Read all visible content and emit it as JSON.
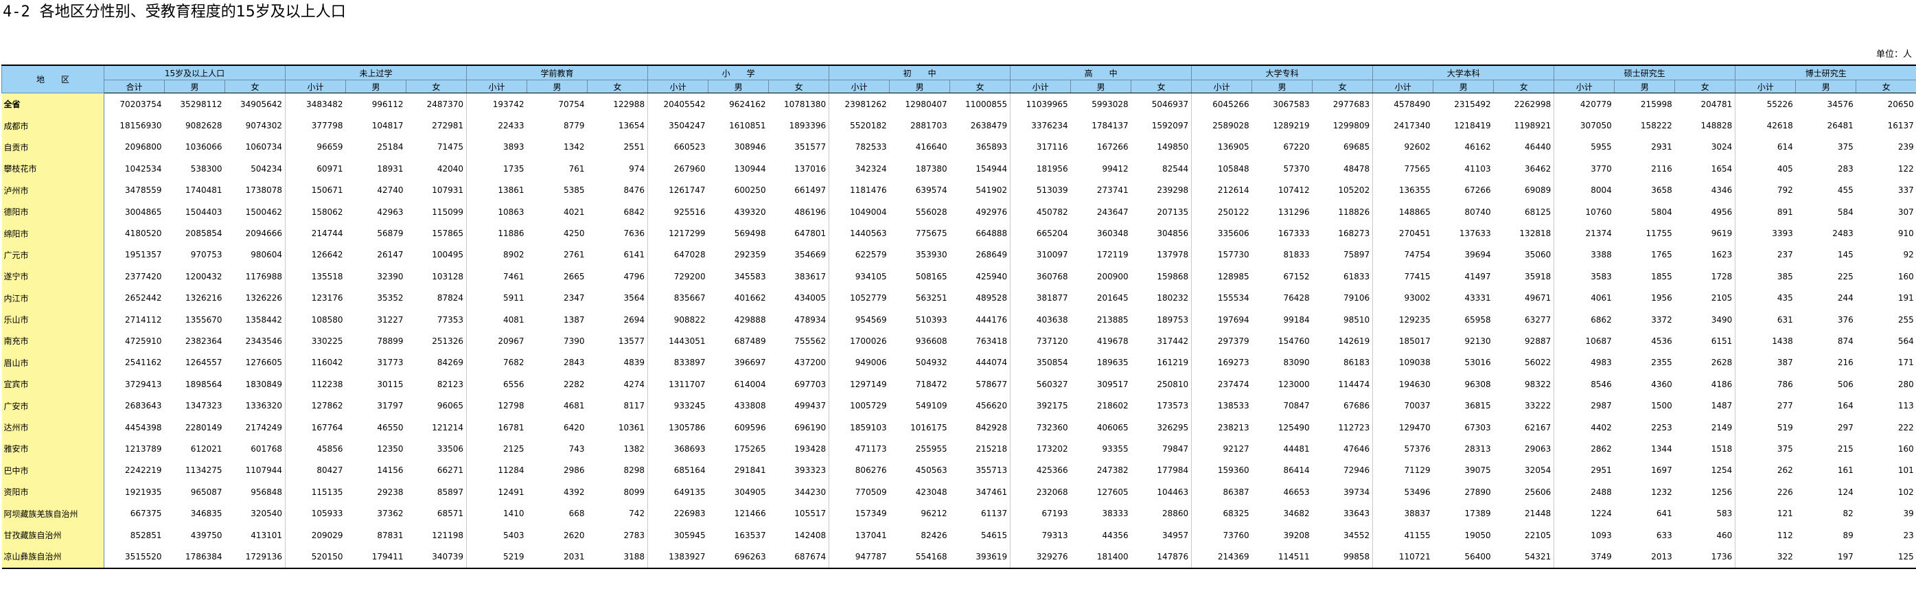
{
  "title": {
    "number": "4-2",
    "text": "各地区分性别、受教育程度的15岁及以上人口"
  },
  "unit_label": "单位：人",
  "table": {
    "region_header": "地　　区",
    "groups": [
      "15岁及以上人口",
      "未上过学",
      "学前教育",
      "小　　学",
      "初　　中",
      "高　　中",
      "大学专科",
      "大学本科",
      "硕士研究生",
      "博士研究生"
    ],
    "subheaders": [
      "合计",
      "男",
      "女",
      "小计",
      "男",
      "女",
      "小计",
      "男",
      "女",
      "小计",
      "男",
      "女",
      "小计",
      "男",
      "女",
      "小计",
      "男",
      "女",
      "小计",
      "男",
      "女",
      "小计",
      "男",
      "女",
      "小计",
      "男",
      "女",
      "小计",
      "男",
      "女"
    ],
    "rows": [
      {
        "region": "全省",
        "values": [
          "70203754",
          "35298112",
          "34905642",
          "3483482",
          "996112",
          "2487370",
          "193742",
          "70754",
          "122988",
          "20405542",
          "9624162",
          "10781380",
          "23981262",
          "12980407",
          "11000855",
          "11039965",
          "5993028",
          "5046937",
          "6045266",
          "3067583",
          "2977683",
          "4578490",
          "2315492",
          "2262998",
          "420779",
          "215998",
          "204781",
          "55226",
          "34576",
          "20650"
        ]
      },
      {
        "region": "成都市",
        "values": [
          "18156930",
          "9082628",
          "9074302",
          "377798",
          "104817",
          "272981",
          "22433",
          "8779",
          "13654",
          "3504247",
          "1610851",
          "1893396",
          "5520182",
          "2881703",
          "2638479",
          "3376234",
          "1784137",
          "1592097",
          "2589028",
          "1289219",
          "1299809",
          "2417340",
          "1218419",
          "1198921",
          "307050",
          "158222",
          "148828",
          "42618",
          "26481",
          "16137"
        ]
      },
      {
        "region": "自贡市",
        "values": [
          "2096800",
          "1036066",
          "1060734",
          "96659",
          "25184",
          "71475",
          "3893",
          "1342",
          "2551",
          "660523",
          "308946",
          "351577",
          "782533",
          "416640",
          "365893",
          "317116",
          "167266",
          "149850",
          "136905",
          "67220",
          "69685",
          "92602",
          "46162",
          "46440",
          "5955",
          "2931",
          "3024",
          "614",
          "375",
          "239"
        ]
      },
      {
        "region": "攀枝花市",
        "values": [
          "1042534",
          "538300",
          "504234",
          "60971",
          "18931",
          "42040",
          "1735",
          "761",
          "974",
          "267960",
          "130944",
          "137016",
          "342324",
          "187380",
          "154944",
          "181956",
          "99412",
          "82544",
          "105848",
          "57370",
          "48478",
          "77565",
          "41103",
          "36462",
          "3770",
          "2116",
          "1654",
          "405",
          "283",
          "122"
        ]
      },
      {
        "region": "泸州市",
        "values": [
          "3478559",
          "1740481",
          "1738078",
          "150671",
          "42740",
          "107931",
          "13861",
          "5385",
          "8476",
          "1261747",
          "600250",
          "661497",
          "1181476",
          "639574",
          "541902",
          "513039",
          "273741",
          "239298",
          "212614",
          "107412",
          "105202",
          "136355",
          "67266",
          "69089",
          "8004",
          "3658",
          "4346",
          "792",
          "455",
          "337"
        ]
      },
      {
        "region": "德阳市",
        "values": [
          "3004865",
          "1504403",
          "1500462",
          "158062",
          "42963",
          "115099",
          "10863",
          "4021",
          "6842",
          "925516",
          "439320",
          "486196",
          "1049004",
          "556028",
          "492976",
          "450782",
          "243647",
          "207135",
          "250122",
          "131296",
          "118826",
          "148865",
          "80740",
          "68125",
          "10760",
          "5804",
          "4956",
          "891",
          "584",
          "307"
        ]
      },
      {
        "region": "绵阳市",
        "values": [
          "4180520",
          "2085854",
          "2094666",
          "214744",
          "56879",
          "157865",
          "11886",
          "4250",
          "7636",
          "1217299",
          "569498",
          "647801",
          "1440563",
          "775675",
          "664888",
          "665204",
          "360348",
          "304856",
          "335606",
          "167333",
          "168273",
          "270451",
          "137633",
          "132818",
          "21374",
          "11755",
          "9619",
          "3393",
          "2483",
          "910"
        ]
      },
      {
        "region": "广元市",
        "values": [
          "1951357",
          "970753",
          "980604",
          "126642",
          "26147",
          "100495",
          "8902",
          "2761",
          "6141",
          "647028",
          "292359",
          "354669",
          "622579",
          "353930",
          "268649",
          "310097",
          "172119",
          "137978",
          "157730",
          "81833",
          "75897",
          "74754",
          "39694",
          "35060",
          "3388",
          "1765",
          "1623",
          "237",
          "145",
          "92"
        ]
      },
      {
        "region": "遂宁市",
        "values": [
          "2377420",
          "1200432",
          "1176988",
          "135518",
          "32390",
          "103128",
          "7461",
          "2665",
          "4796",
          "729200",
          "345583",
          "383617",
          "934105",
          "508165",
          "425940",
          "360768",
          "200900",
          "159868",
          "128985",
          "67152",
          "61833",
          "77415",
          "41497",
          "35918",
          "3583",
          "1855",
          "1728",
          "385",
          "225",
          "160"
        ]
      },
      {
        "region": "内江市",
        "values": [
          "2652442",
          "1326216",
          "1326226",
          "123176",
          "35352",
          "87824",
          "5911",
          "2347",
          "3564",
          "835667",
          "401662",
          "434005",
          "1052779",
          "563251",
          "489528",
          "381877",
          "201645",
          "180232",
          "155534",
          "76428",
          "79106",
          "93002",
          "43331",
          "49671",
          "4061",
          "1956",
          "2105",
          "435",
          "244",
          "191"
        ]
      },
      {
        "region": "乐山市",
        "values": [
          "2714112",
          "1355670",
          "1358442",
          "108580",
          "31227",
          "77353",
          "4081",
          "1387",
          "2694",
          "908822",
          "429888",
          "478934",
          "954569",
          "510393",
          "444176",
          "403638",
          "213885",
          "189753",
          "197694",
          "99184",
          "98510",
          "129235",
          "65958",
          "63277",
          "6862",
          "3372",
          "3490",
          "631",
          "376",
          "255"
        ]
      },
      {
        "region": "南充市",
        "values": [
          "4725910",
          "2382364",
          "2343546",
          "330225",
          "78899",
          "251326",
          "20967",
          "7390",
          "13577",
          "1443051",
          "687489",
          "755562",
          "1700026",
          "936608",
          "763418",
          "737120",
          "419678",
          "317442",
          "297379",
          "154760",
          "142619",
          "185017",
          "92130",
          "92887",
          "10687",
          "4536",
          "6151",
          "1438",
          "874",
          "564"
        ]
      },
      {
        "region": "眉山市",
        "values": [
          "2541162",
          "1264557",
          "1276605",
          "116042",
          "31773",
          "84269",
          "7682",
          "2843",
          "4839",
          "833897",
          "396697",
          "437200",
          "949006",
          "504932",
          "444074",
          "350854",
          "189635",
          "161219",
          "169273",
          "83090",
          "86183",
          "109038",
          "53016",
          "56022",
          "4983",
          "2355",
          "2628",
          "387",
          "216",
          "171"
        ]
      },
      {
        "region": "宜宾市",
        "values": [
          "3729413",
          "1898564",
          "1830849",
          "112238",
          "30115",
          "82123",
          "6556",
          "2282",
          "4274",
          "1311707",
          "614004",
          "697703",
          "1297149",
          "718472",
          "578677",
          "560327",
          "309517",
          "250810",
          "237474",
          "123000",
          "114474",
          "194630",
          "96308",
          "98322",
          "8546",
          "4360",
          "4186",
          "786",
          "506",
          "280"
        ]
      },
      {
        "region": "广安市",
        "values": [
          "2683643",
          "1347323",
          "1336320",
          "127862",
          "31797",
          "96065",
          "12798",
          "4681",
          "8117",
          "933245",
          "433808",
          "499437",
          "1005729",
          "549109",
          "456620",
          "392175",
          "218602",
          "173573",
          "138533",
          "70847",
          "67686",
          "70037",
          "36815",
          "33222",
          "2987",
          "1500",
          "1487",
          "277",
          "164",
          "113"
        ]
      },
      {
        "region": "达州市",
        "values": [
          "4454398",
          "2280149",
          "2174249",
          "167764",
          "46550",
          "121214",
          "16781",
          "6420",
          "10361",
          "1305786",
          "609596",
          "696190",
          "1859103",
          "1016175",
          "842928",
          "732360",
          "406065",
          "326295",
          "238213",
          "125490",
          "112723",
          "129470",
          "67303",
          "62167",
          "4402",
          "2253",
          "2149",
          "519",
          "297",
          "222"
        ]
      },
      {
        "region": "雅安市",
        "values": [
          "1213789",
          "612021",
          "601768",
          "45856",
          "12350",
          "33506",
          "2125",
          "743",
          "1382",
          "368693",
          "175265",
          "193428",
          "471173",
          "255955",
          "215218",
          "173202",
          "93355",
          "79847",
          "92127",
          "44481",
          "47646",
          "57376",
          "28313",
          "29063",
          "2862",
          "1344",
          "1518",
          "375",
          "215",
          "160"
        ]
      },
      {
        "region": "巴中市",
        "values": [
          "2242219",
          "1134275",
          "1107944",
          "80427",
          "14156",
          "66271",
          "11284",
          "2986",
          "8298",
          "685164",
          "291841",
          "393323",
          "806276",
          "450563",
          "355713",
          "425366",
          "247382",
          "177984",
          "159360",
          "86414",
          "72946",
          "71129",
          "39075",
          "32054",
          "2951",
          "1697",
          "1254",
          "262",
          "161",
          "101"
        ]
      },
      {
        "region": "资阳市",
        "values": [
          "1921935",
          "965087",
          "956848",
          "115135",
          "29238",
          "85897",
          "12491",
          "4392",
          "8099",
          "649135",
          "304905",
          "344230",
          "770509",
          "423048",
          "347461",
          "232068",
          "127605",
          "104463",
          "86387",
          "46653",
          "39734",
          "53496",
          "27890",
          "25606",
          "2488",
          "1232",
          "1256",
          "226",
          "124",
          "102"
        ]
      },
      {
        "region": "阿坝藏族羌族自治州",
        "values": [
          "667375",
          "346835",
          "320540",
          "105933",
          "37362",
          "68571",
          "1410",
          "668",
          "742",
          "226983",
          "121466",
          "105517",
          "157349",
          "96212",
          "61137",
          "67193",
          "38333",
          "28860",
          "68325",
          "34682",
          "33643",
          "38837",
          "17389",
          "21448",
          "1224",
          "641",
          "583",
          "121",
          "82",
          "39"
        ]
      },
      {
        "region": "甘孜藏族自治州",
        "values": [
          "852851",
          "439750",
          "413101",
          "209029",
          "87831",
          "121198",
          "5403",
          "2620",
          "2783",
          "305945",
          "163537",
          "142408",
          "137041",
          "82426",
          "54615",
          "79313",
          "44356",
          "34957",
          "73760",
          "39208",
          "34552",
          "41155",
          "19050",
          "22105",
          "1093",
          "633",
          "460",
          "112",
          "89",
          "23"
        ]
      },
      {
        "region": "凉山彝族自治州",
        "values": [
          "3515520",
          "1786384",
          "1729136",
          "520150",
          "179411",
          "340739",
          "5219",
          "2031",
          "3188",
          "1383927",
          "696263",
          "687674",
          "947787",
          "554168",
          "393619",
          "329276",
          "181400",
          "147876",
          "214369",
          "114511",
          "99858",
          "110721",
          "56400",
          "54321",
          "3749",
          "2013",
          "1736",
          "322",
          "197",
          "125"
        ]
      }
    ]
  }
}
